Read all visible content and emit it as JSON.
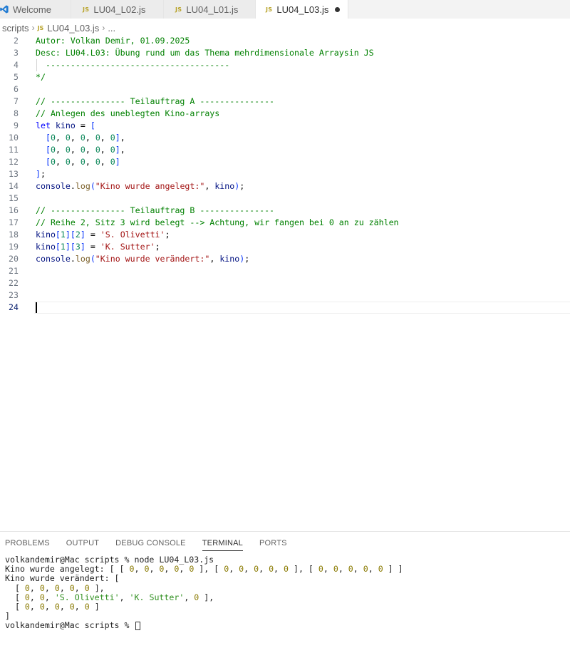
{
  "tabs": [
    {
      "label": "Welcome",
      "icon": "vscode-logo-icon",
      "active": false
    },
    {
      "label": "LU04_L02.js",
      "icon": "js-file-icon",
      "active": false
    },
    {
      "label": "LU04_L01.js",
      "icon": "js-file-icon",
      "active": false
    },
    {
      "label": "LU04_L03.js",
      "icon": "js-file-icon",
      "active": true,
      "modified": true
    }
  ],
  "js_badge": "JS",
  "breadcrumb": {
    "folder": "scripts",
    "file": "LU04_L03.js",
    "more": "..."
  },
  "editor": {
    "active_line": 24,
    "lines": [
      {
        "n": "2",
        "text": "Autor: Volkan Demir, 01.09.2025"
      },
      {
        "n": "3",
        "text": "Desc: LU04.L03: Übung rund um das Thema mehrdimensionale Arraysin JS"
      },
      {
        "n": "4",
        "text": "  -------------------------------------"
      },
      {
        "n": "5",
        "text": "*/"
      },
      {
        "n": "6",
        "text": ""
      },
      {
        "n": "7",
        "text": "// --------------- Teilauftrag A ---------------"
      },
      {
        "n": "8",
        "text": "// Anlegen des uneblegten Kino-arrays"
      },
      {
        "n": "9",
        "text": "let kino = ["
      },
      {
        "n": "10",
        "text": "  [0, 0, 0, 0, 0],"
      },
      {
        "n": "11",
        "text": "  [0, 0, 0, 0, 0],"
      },
      {
        "n": "12",
        "text": "  [0, 0, 0, 0, 0]"
      },
      {
        "n": "13",
        "text": "];"
      },
      {
        "n": "14",
        "text": "console.log(\"Kino wurde angelegt:\", kino);"
      },
      {
        "n": "15",
        "text": ""
      },
      {
        "n": "16",
        "text": "// --------------- Teilauftrag B ---------------"
      },
      {
        "n": "17",
        "text": "// Reihe 2, Sitz 3 wird belegt --> Achtung, wir fangen bei 0 an zu zählen"
      },
      {
        "n": "18",
        "text": "kino[1][2] = 'S. Olivetti';"
      },
      {
        "n": "19",
        "text": "kino[1][3] = 'K. Sutter';"
      },
      {
        "n": "20",
        "text": "console.log(\"Kino wurde verändert:\", kino);"
      },
      {
        "n": "21",
        "text": ""
      },
      {
        "n": "22",
        "text": ""
      },
      {
        "n": "23",
        "text": ""
      },
      {
        "n": "24",
        "text": ""
      }
    ]
  },
  "panel": {
    "tabs": [
      {
        "label": "PROBLEMS",
        "active": false
      },
      {
        "label": "OUTPUT",
        "active": false
      },
      {
        "label": "DEBUG CONSOLE",
        "active": false
      },
      {
        "label": "TERMINAL",
        "active": true
      },
      {
        "label": "PORTS",
        "active": false
      }
    ],
    "terminal_lines": [
      "volkandemir@Mac scripts % node LU04_L03.js",
      "Kino wurde angelegt: [ [ 0, 0, 0, 0, 0 ], [ 0, 0, 0, 0, 0 ], [ 0, 0, 0, 0, 0 ] ]",
      "Kino wurde verändert: [",
      "  [ 0, 0, 0, 0, 0 ],",
      "  [ 0, 0, 'S. Olivetti', 'K. Sutter', 0 ],",
      "  [ 0, 0, 0, 0, 0 ]",
      "]",
      "volkandemir@Mac scripts % "
    ]
  }
}
